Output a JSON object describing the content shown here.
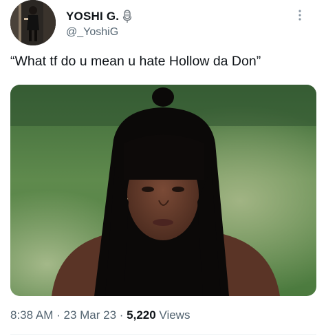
{
  "user": {
    "display_name": "YOSHI G.",
    "handle": "@_YoshiG",
    "badge_icon": "microphone-icon"
  },
  "tweet": {
    "text": "“What tf do u mean u hate Hollow da Don”"
  },
  "meta": {
    "time": "8:38 AM",
    "sep1": " · ",
    "date": "23 Mar 23",
    "sep2": " · ",
    "views_count": "5,220",
    "views_label": " Views"
  },
  "colors": {
    "text_primary": "#0f1419",
    "text_secondary": "#536471",
    "divider": "#eff3f4"
  }
}
